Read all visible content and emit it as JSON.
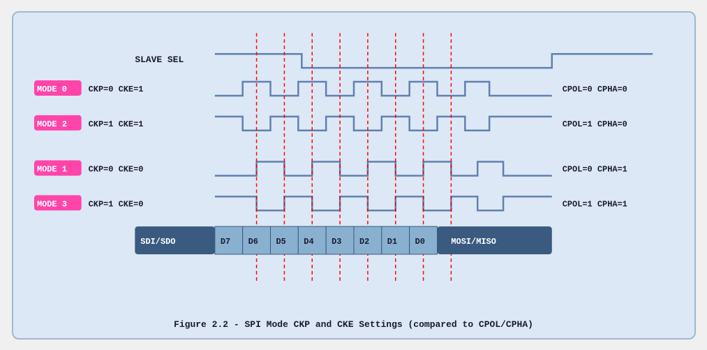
{
  "caption": "Figure 2.2 - SPI Mode CKP and CKE Settings (compared to CPOL/CPHA)",
  "diagram": {
    "slave_sel_label": "SLAVE SEL",
    "modes": [
      {
        "id": "MODE 0",
        "ckp_cke": "CKP=0  CKE=1",
        "cpol_cpha": "CPOL=0  CPHA=0"
      },
      {
        "id": "MODE 2",
        "ckp_cke": "CKP=1  CKE=1",
        "cpol_cpha": "CPOL=1  CPHA=0"
      },
      {
        "id": "MODE 1",
        "ckp_cke": "CKP=0  CKE=0",
        "cpol_cpha": "CPOL=0  CPHA=1"
      },
      {
        "id": "MODE 3",
        "ckp_cke": "CKP=1  CKE=0",
        "cpol_cpha": "CPOL=1  CPHA=1"
      }
    ],
    "data_bits": [
      "SDI/SDO",
      "D7",
      "D6",
      "D5",
      "D4",
      "D3",
      "D2",
      "D1",
      "D0",
      "MOSI/MISO"
    ],
    "colors": {
      "badge_bg": "#ff44aa",
      "waveform": "#6080b0",
      "dashed_line": "#ff0000",
      "data_bar_dark": "#3a5a80",
      "data_bar_light": "#8ab0d0",
      "text_dark": "#1a1a2e"
    }
  }
}
